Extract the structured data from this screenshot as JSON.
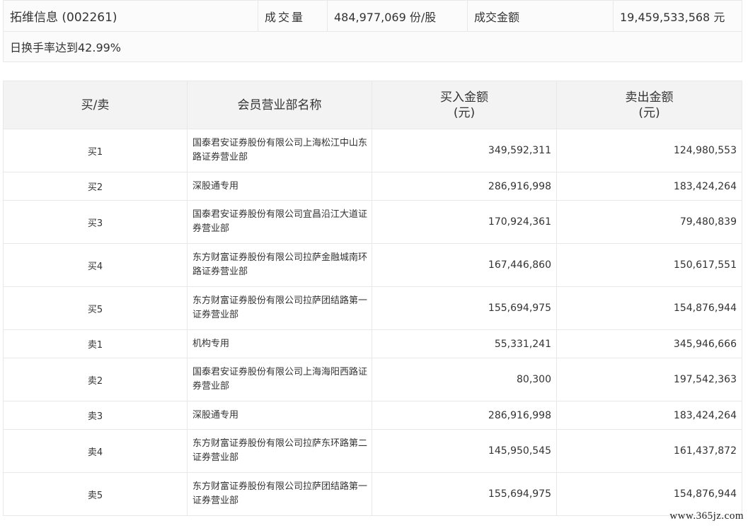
{
  "summary": {
    "stock": "拓维信息 (002261)",
    "volume_label": "成交量",
    "volume_value": "484,977,069 份/股",
    "amount_label": "成交金额",
    "amount_value": "19,459,533,568 元",
    "turnover_note": "日换手率达到42.99%"
  },
  "table": {
    "headers": {
      "side": "买/卖",
      "dept": "会员营业部名称",
      "buy_line1": "买入金额",
      "buy_line2": "(元)",
      "sell_line1": "卖出金额",
      "sell_line2": "(元)"
    },
    "rows": [
      {
        "side": "买1",
        "dept": "国泰君安证券股份有限公司上海松江中山东路证券营业部",
        "buy": "349,592,311",
        "sell": "124,980,553"
      },
      {
        "side": "买2",
        "dept": "深股通专用",
        "buy": "286,916,998",
        "sell": "183,424,264"
      },
      {
        "side": "买3",
        "dept": "国泰君安证券股份有限公司宜昌沿江大道证券营业部",
        "buy": "170,924,361",
        "sell": "79,480,839"
      },
      {
        "side": "买4",
        "dept": "东方财富证券股份有限公司拉萨金融城南环路证券营业部",
        "buy": "167,446,860",
        "sell": "150,617,551"
      },
      {
        "side": "买5",
        "dept": "东方财富证券股份有限公司拉萨团结路第一证券营业部",
        "buy": "155,694,975",
        "sell": "154,876,944"
      },
      {
        "side": "卖1",
        "dept": "机构专用",
        "buy": "55,331,241",
        "sell": "345,946,666"
      },
      {
        "side": "卖2",
        "dept": "国泰君安证券股份有限公司上海海阳西路证券营业部",
        "buy": "80,300",
        "sell": "197,542,363"
      },
      {
        "side": "卖3",
        "dept": "深股通专用",
        "buy": "286,916,998",
        "sell": "183,424,264"
      },
      {
        "side": "卖4",
        "dept": "东方财富证券股份有限公司拉萨东环路第二证券营业部",
        "buy": "145,950,545",
        "sell": "161,437,872"
      },
      {
        "side": "卖5",
        "dept": "东方财富证券股份有限公司拉萨团结路第一证券营业部",
        "buy": "155,694,975",
        "sell": "154,876,944"
      }
    ]
  },
  "watermark": "www.365jz.com"
}
